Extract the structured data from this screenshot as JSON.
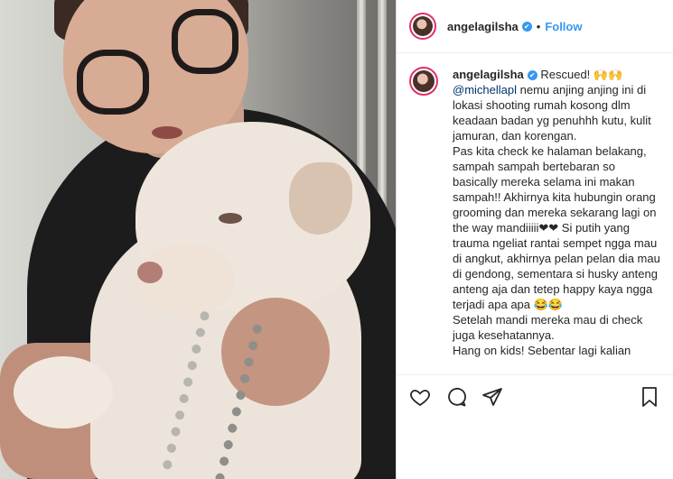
{
  "post": {
    "username": "angelagilsha",
    "verified_mark": "✔",
    "separator": "•",
    "follow_label": "Follow"
  },
  "caption": {
    "username": "angelagilsha",
    "opening": " Rescued! 🙌🙌",
    "mention": "@michellapl",
    "text_part1": " nemu anjing anjing ini di lokasi shooting rumah kosong dlm keadaan badan yg penuhhh kutu, kulit jamuran, dan korengan.",
    "text_part2": "Pas kita check ke halaman belakang, sampah sampah bertebaran so basically mereka selama ini makan sampah!! Akhirnya kita hubungin orang grooming dan mereka sekarang lagi on the way mandiiiii❤❤ Si putih yang trauma ngeliat rantai sempet ngga mau di angkut, akhirnya pelan pelan dia mau di gendong, sementara si husky anteng anteng aja dan tetep happy kaya ngga terjadi apa apa 😂😂",
    "text_part3": "Setelah mandi mereka mau di check juga kesehatannya.",
    "text_part4": "Hang on kids! Sebentar lagi kalian"
  },
  "icons": {
    "like": "heart-icon",
    "comment": "comment-icon",
    "share": "share-icon",
    "save": "bookmark-icon"
  },
  "colors": {
    "link": "#3897f0",
    "story_ring": "#e1306c",
    "verified": "#3897f0"
  }
}
